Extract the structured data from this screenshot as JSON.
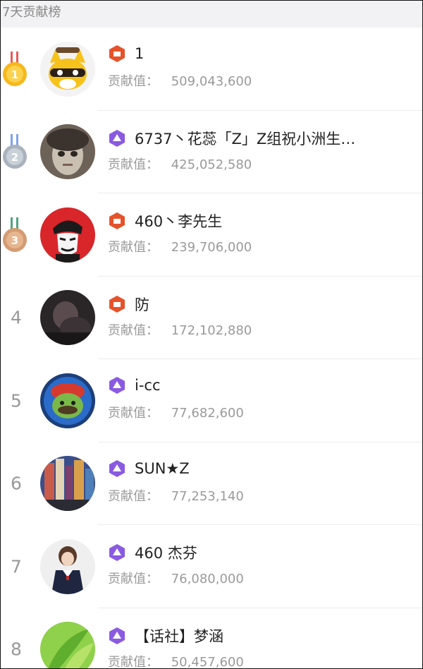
{
  "header": {
    "title": "7天贡献榜"
  },
  "score_label": "贡献值：",
  "rows": [
    {
      "rank": "1",
      "name": "1",
      "score": "509,043,600",
      "medal": "gold",
      "level": "red"
    },
    {
      "rank": "2",
      "name": "6737丶花蕊「Z」Z组祝小洲生…",
      "score": "425,052,580",
      "medal": "silver",
      "level": "purple"
    },
    {
      "rank": "3",
      "name": "460丶李先生",
      "score": "239,706,000",
      "medal": "bronze",
      "level": "red"
    },
    {
      "rank": "4",
      "name": "防",
      "score": "172,102,880",
      "medal": "",
      "level": "red"
    },
    {
      "rank": "5",
      "name": "i-cc",
      "score": "77,682,600",
      "medal": "",
      "level": "purple"
    },
    {
      "rank": "6",
      "name": "SUN★Z",
      "score": "77,253,140",
      "medal": "",
      "level": "purple"
    },
    {
      "rank": "7",
      "name": "460 杰芬",
      "score": "76,080,000",
      "medal": "",
      "level": "purple"
    },
    {
      "rank": "8",
      "name": "【话社】梦涵",
      "score": "50,457,600",
      "medal": "",
      "level": "purple"
    }
  ],
  "colors": {
    "gold": "#f6b81a",
    "silver": "#a9b2bd",
    "bronze": "#d59b73",
    "level_red": "#e5532b",
    "level_purple": "#8a5be0"
  }
}
